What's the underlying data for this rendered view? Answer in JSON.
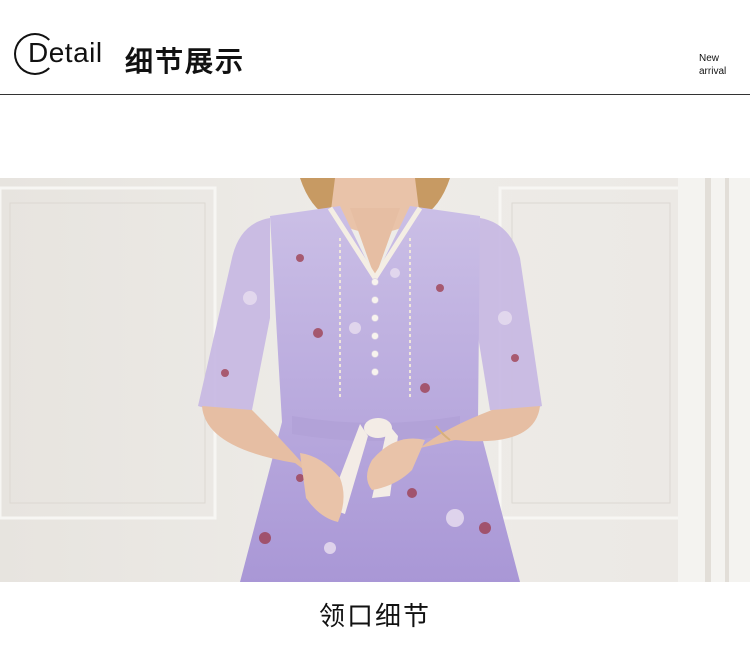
{
  "header": {
    "detail_label": "Detail",
    "title": "细节展示",
    "badge_line1": "New",
    "badge_line2": "arrival"
  },
  "photo": {
    "subject": "lavender-floral-dress-neckline",
    "colors": {
      "wall": "#eceae6",
      "dress": "#b9a7de",
      "skin": "#e9c3a9",
      "hair": "#c79a63",
      "sash": "#f3ece6",
      "floral_red": "#9c3a4a"
    }
  },
  "caption": "领口细节"
}
